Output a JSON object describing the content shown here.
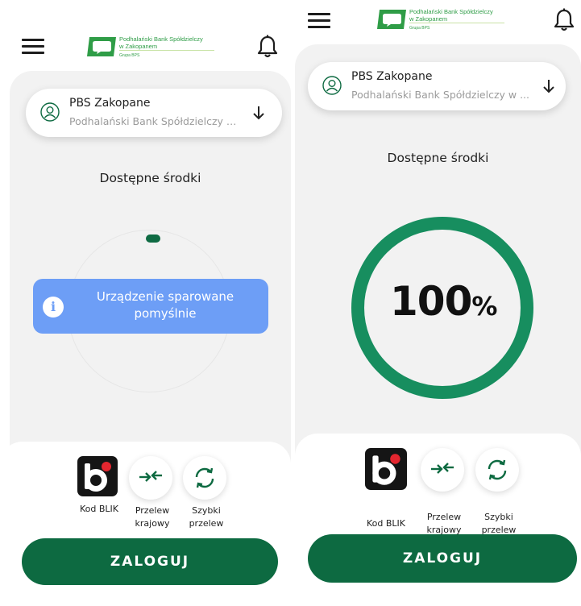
{
  "header": {
    "logo_name": "Podhalański Bank Spółdzielczy",
    "logo_name_2": "w Zakopanem",
    "logo_group": "Grupa BPS",
    "menu_icon": "hamburger-icon",
    "notification_icon": "bell-icon"
  },
  "account": {
    "name": "PBS Zakopane",
    "subtitle": "Podhalański Bank Spółdzielczy w...",
    "subtitle_right": "Podhalański Bank Spółdzielczy w ..."
  },
  "balance": {
    "title": "Dostępne środki",
    "percent_value": "100",
    "percent_sign": "%",
    "progress": 1.0
  },
  "toast": {
    "message": "Urządzenie sparowane pomyślnie",
    "icon": "info-icon"
  },
  "actions": [
    {
      "label_line1": "Kod BLIK",
      "label_line2": "",
      "icon": "blik-icon"
    },
    {
      "label_line1": "Przelew",
      "label_line2": "krajowy",
      "icon": "transfer-arrows-icon"
    },
    {
      "label_line1": "Szybki",
      "label_line2": "przelew",
      "icon": "refresh-arrows-icon"
    }
  ],
  "login_button": {
    "label": "ZALOGUJ"
  },
  "colors": {
    "brand_green": "#0d6a41",
    "ring_green": "#178e5f",
    "logo_green": "#2f9d47",
    "toast_blue": "#6d9ef6",
    "blik_red": "#e3262f"
  }
}
